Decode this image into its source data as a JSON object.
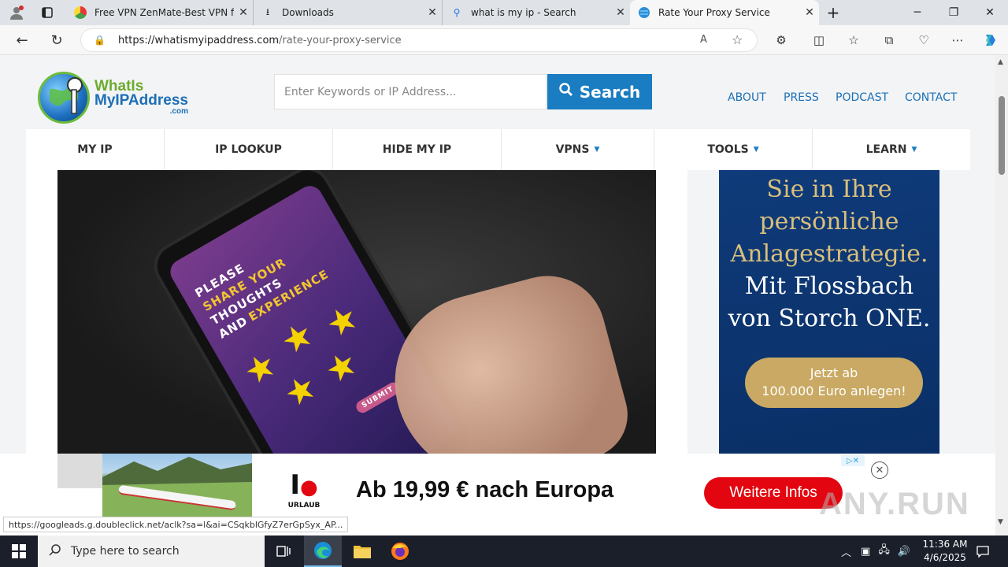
{
  "browser": {
    "tabs": [
      {
        "title": "Free VPN ZenMate-Best VPN for"
      },
      {
        "title": "Downloads"
      },
      {
        "title": "what is my ip - Search"
      },
      {
        "title": "Rate Your Proxy Service"
      }
    ],
    "url_domain": "https://whatismyipaddress.com",
    "url_path": "/rate-your-proxy-service"
  },
  "site": {
    "logo": {
      "line1": "WhatIs",
      "line2": "MyIPAddress",
      "line3": ".com"
    },
    "search_placeholder": "Enter Keywords or IP Address...",
    "search_button": "Search",
    "top_links": [
      "ABOUT",
      "PRESS",
      "PODCAST",
      "CONTACT"
    ],
    "nav": [
      {
        "label": "MY IP"
      },
      {
        "label": "IP LOOKUP"
      },
      {
        "label": "HIDE MY IP"
      },
      {
        "label": "VPNS"
      },
      {
        "label": "TOOLS"
      },
      {
        "label": "LEARN"
      }
    ],
    "hero_text": [
      "PLEASE",
      "SHARE YOUR",
      "THOUGHTS",
      "AND",
      "EXPERIENCE",
      "SUBMIT"
    ]
  },
  "side_ad": {
    "lines_gold": [
      "Sie in Ihre",
      "persönliche",
      "Anlagestrategie."
    ],
    "lines_white": [
      "Mit Flossbach",
      "von Storch ONE."
    ],
    "cta_line1": "Jetzt ab",
    "cta_line2": "100.000 Euro anlegen!"
  },
  "banner_ad": {
    "logo_big": "I",
    "logo_small": "URLAUB",
    "headline": "Ab 19,99 € nach Europa",
    "cta": "Weitere Infos",
    "watermark": "ANY.RUN"
  },
  "status_url": "https://googleads.g.doubleclick.net/aclk?sa=l&ai=CSqkblGfyZ7erGpSyx_AP...",
  "taskbar": {
    "search_placeholder": "Type here to search",
    "time": "11:36 AM",
    "date": "4/6/2025"
  },
  "colors": {
    "accent": "#1a7cc1",
    "banner_red": "#e3050f",
    "ad_navy": "#0f3b7a",
    "ad_gold": "#d9bf7c"
  }
}
